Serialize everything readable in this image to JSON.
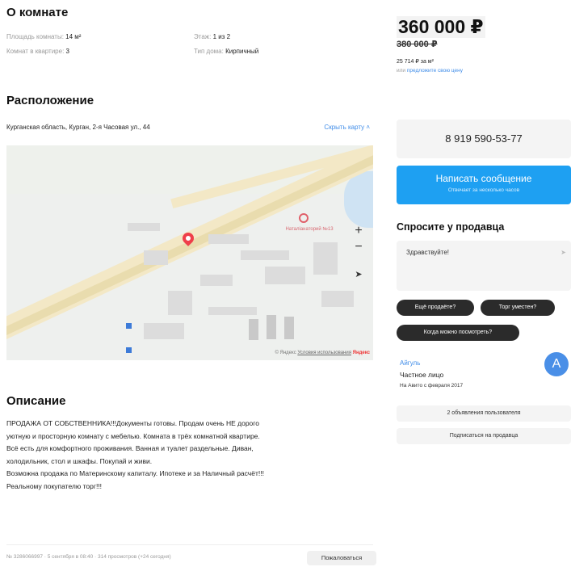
{
  "about": {
    "title": "О комнате",
    "area_label": "Площадь комнаты:",
    "area_value": "14 м²",
    "rooms_label": "Комнат в квартире:",
    "rooms_value": "3",
    "floor_label": "Этаж:",
    "floor_value": "1 из 2",
    "house_label": "Тип дома:",
    "house_value": "Кирпичный"
  },
  "location": {
    "title": "Расположение",
    "address": "Курганская область, Курган, 2-я Часовая ул., 44",
    "hide_map": "Скрыть карту ˄",
    "poi_label": "Наталіанаторий №13",
    "zoom_in": "+",
    "zoom_out": "−",
    "geo": "➤",
    "copy_prefix": "© Яндекс",
    "copy_link": "Условия использования",
    "copy_brand": "Яндекс"
  },
  "description": {
    "title": "Описание",
    "lines": [
      "ПРОДАЖА ОТ СОБСТВЕННИКА!!!Документы готовы. Продам очень НЕ дорого",
      "уютную и просторную комнату с мебелью. Комната в трёх комнатной квартире.",
      "Всё есть для комфортного проживания. Ванная и туалет раздельные. Диван,",
      "холодильник, стол и шкафы. Покупай и живи.",
      "Возможна продажа по Материнскому капиталу. Ипотеке и за Наличный расчёт!!!",
      "Реальному покупателю торг!!!"
    ]
  },
  "footer": {
    "meta": "№ 3286066997 · 5 сентября в 08:40 · 314 просмотров (+24 сегодня)",
    "complain": "Пожаловаться"
  },
  "price": {
    "current": "360 000 ₽",
    "old": "380 000 ₽",
    "per_m": "25 714 ₽ за м²",
    "offer_prefix": "или",
    "offer_link": "предложите свою цену"
  },
  "contact": {
    "phone": "8 919 590-53-77",
    "message_btn": "Написать сообщение",
    "message_sub": "Отвечает за несколько часов"
  },
  "ask": {
    "title": "Спросите у продавца",
    "input_value": "Здравствуйте!",
    "send": "➤",
    "chips": [
      "Ещё продаёте?",
      "Торг уместен?",
      "Когда можно посмотреть?"
    ]
  },
  "seller": {
    "name": "Айгуль",
    "type": "Частное лицо",
    "since": "На Авито с февраля 2017",
    "avatar_letter": "A",
    "listings_btn": "2 объявления пользователя",
    "subscribe_btn": "Подписаться на продавца"
  },
  "colors": {
    "accent": "#1ea0f2",
    "link": "#3f8ce8",
    "pin": "#ef3f4a",
    "avatar": "#4a8fe7"
  }
}
